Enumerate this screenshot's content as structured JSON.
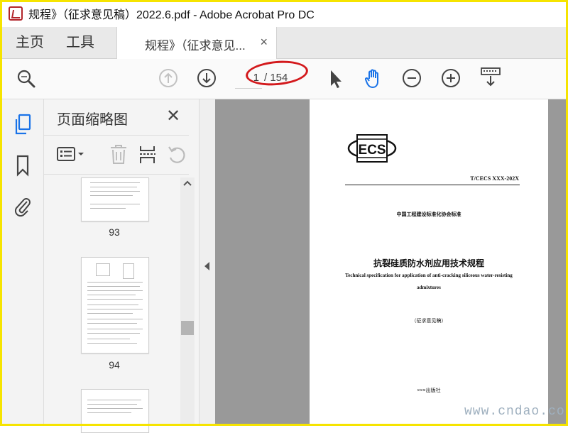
{
  "window": {
    "title": "规程》（征求意见稿）2022.6.pdf - Adobe Acrobat Pro DC"
  },
  "tabs": {
    "home": "主页",
    "tools": "工具",
    "document": "规程》（征求意见...",
    "close_glyph": "×"
  },
  "toolbar": {
    "zoom_icon": "search-zoom-icon",
    "prev_icon": "arrow-up-circle-icon",
    "next_icon": "arrow-down-circle-icon",
    "page_current": "1",
    "page_total": "/ 154",
    "tools": [
      "select-arrow-icon",
      "hand-icon",
      "zoom-out-icon",
      "zoom-in-icon",
      "keyboard-scroll-icon"
    ],
    "hand_color": "#1a73e8"
  },
  "left_rail": {
    "items": [
      "page-thumbnails-icon",
      "bookmark-icon",
      "attachment-icon"
    ],
    "active_color": "#1a73e8"
  },
  "thumbnail_panel": {
    "title": "页面缩略图",
    "close_glyph": "✕",
    "tools": [
      "options-menu-icon",
      "delete-icon",
      "extract-icon",
      "rotate-icon"
    ],
    "thumbnails": [
      {
        "label": "93"
      },
      {
        "label": "94"
      }
    ]
  },
  "document": {
    "logo_text": "ECS",
    "standard_number": "T/CECS XXX-202X",
    "association": "中国工程建设标准化协会标准",
    "title_cn": "抗裂硅质防水剂应用技术规程",
    "title_en_line1": "Technical specification for application of anti-cracking siliceous water-resisting",
    "title_en_line2": "admixtures",
    "draft_note": "（征求意见稿）",
    "publisher": "×××出版社"
  },
  "watermark": "www.cndao.co",
  "colors": {
    "frame": "#f6e400",
    "annotation": "#d3191c",
    "doc_background": "#999999"
  }
}
